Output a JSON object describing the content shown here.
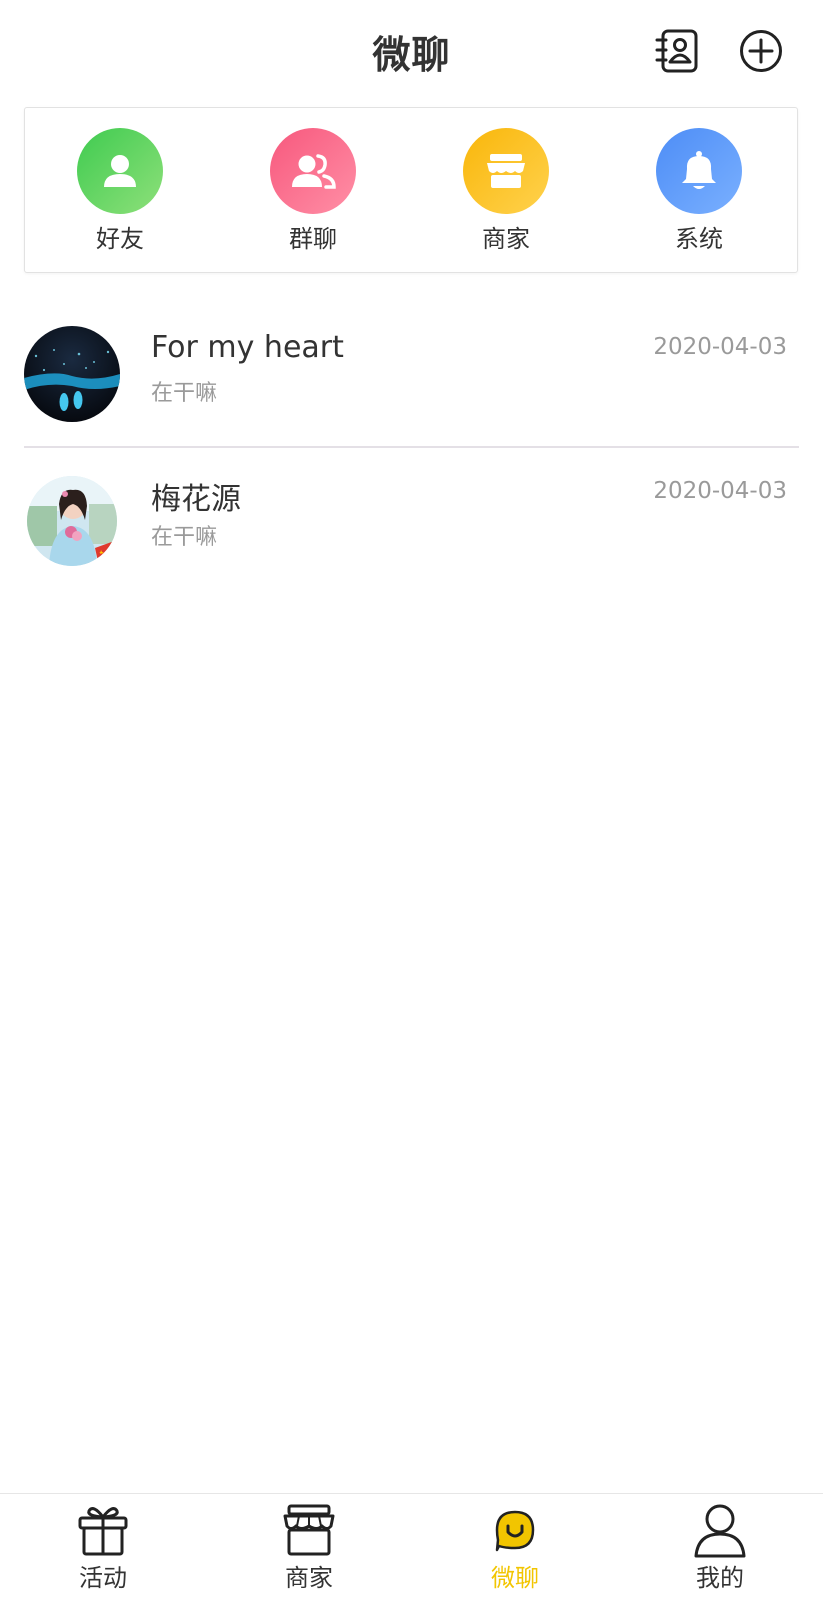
{
  "header": {
    "title": "微聊"
  },
  "categories": [
    {
      "label": "好友",
      "icon": "friend-icon",
      "color": "#3fcb50"
    },
    {
      "label": "群聊",
      "icon": "group-chat-icon",
      "color": "#f7587d"
    },
    {
      "label": "商家",
      "icon": "shop-icon",
      "color": "#f9b60a"
    },
    {
      "label": "系统",
      "icon": "bell-icon",
      "color": "#4d8df6"
    }
  ],
  "chats": [
    {
      "name": "For my heart",
      "message": "在干嘛",
      "date": "2020-04-03"
    },
    {
      "name": "梅花源",
      "message": "在干嘛",
      "date": "2020-04-03"
    }
  ],
  "tabbar": {
    "items": [
      {
        "label": "活动",
        "icon": "gift-icon"
      },
      {
        "label": "商家",
        "icon": "shop-icon"
      },
      {
        "label": "微聊",
        "icon": "chat-smile-icon"
      },
      {
        "label": "我的",
        "icon": "person-icon"
      }
    ],
    "active_index": 2,
    "active_color": "#f2c500"
  }
}
